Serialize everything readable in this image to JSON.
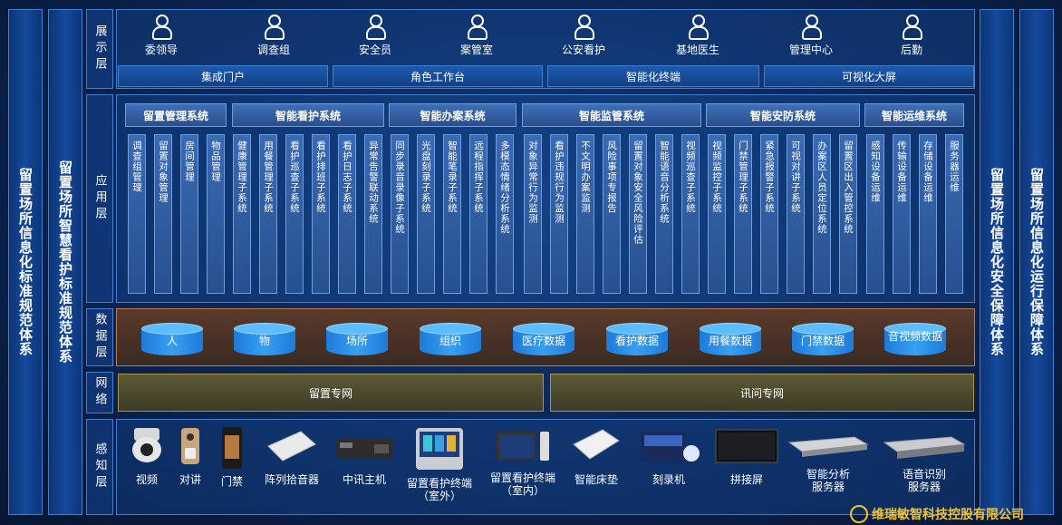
{
  "side_bars": {
    "left_outer": "留置场所信息化标准规范体系",
    "left_inner": "留置场所智慧看护标准规范体系",
    "right_inner": "留置场所信息化安全保障体系",
    "right_outer": "留置场所信息化运行保障体系"
  },
  "layers": {
    "display": "展示层",
    "application": "应用层",
    "data": "数据层",
    "network": "网络",
    "perception": "感知层"
  },
  "roles": [
    "委领导",
    "调查组",
    "安全员",
    "案管室",
    "公安看护",
    "基地医生",
    "管理中心",
    "后勤"
  ],
  "entrances": [
    "集成门户",
    "角色工作台",
    "智能化终端",
    "可视化大屏"
  ],
  "groups": [
    "留置管理系统",
    "智能看护系统",
    "智能办案系统",
    "智能监管系统",
    "智能安防系统",
    "智能运维系统"
  ],
  "modules": [
    "调查组管理",
    "留置对象管理",
    "房间管理",
    "物品管理",
    "健康管理子系统",
    "用餐管理子系统",
    "看护巡查子系统",
    "看护排班子系统",
    "看护日志子系统",
    "异常告警联动系统",
    "同步录音录像子系统",
    "光盘刻录子系统",
    "智能笔录子系统",
    "远程指挥子系统",
    "多模态情绪分析系统",
    "对象异常行为监测",
    "看护违规行为监测",
    "不文明办案监测",
    "风险事项专报告",
    "留置对象安全风险评估",
    "智能语音分析系统",
    "视频巡查子系统",
    "视频监控子系统",
    "门禁管理子系统",
    "紧急报警子系统",
    "可视对讲子系统",
    "办案区人员定位系统",
    "留置区出入管控系统",
    "感知设备运维",
    "传输设备运维",
    "存储设备运维",
    "服务器运维"
  ],
  "data_stores": [
    "人",
    "物",
    "场所",
    "组织",
    "医疗数据",
    "看护数据",
    "用餐数据",
    "门禁数据",
    "音视频数据"
  ],
  "networks": [
    "留置专网",
    "讯问专网"
  ],
  "devices": [
    "视频",
    "对讲",
    "门禁",
    "阵列拾音器",
    "中讯主机",
    "留置看护终端\n（室外）",
    "留置看护终端\n（室内）",
    "智能床垫",
    "刻录机",
    "拼接屏",
    "智能分析\n服务器",
    "语音识别\n服务器"
  ],
  "company": "维瑞敏智科技控股有限公司"
}
